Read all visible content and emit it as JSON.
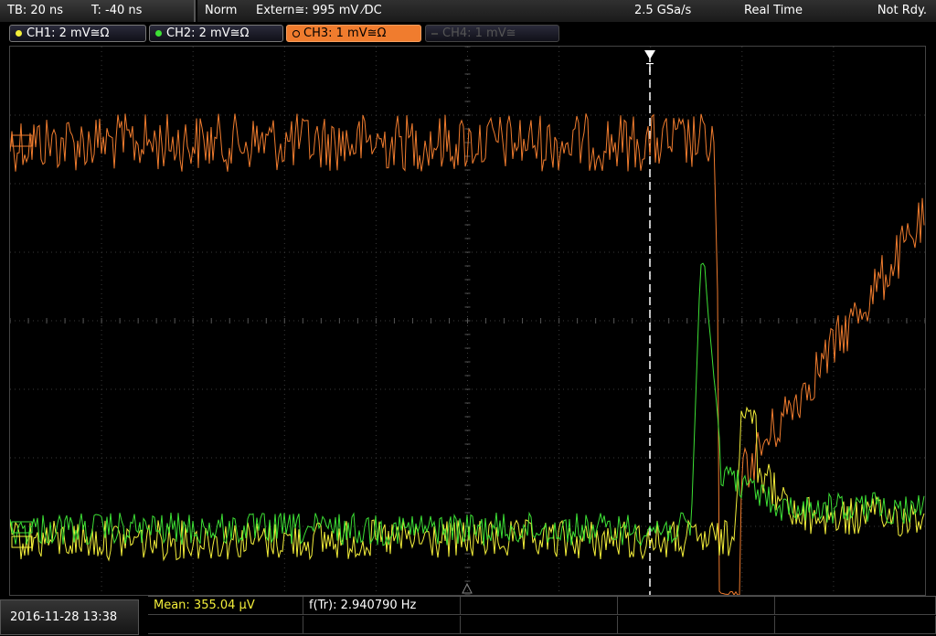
{
  "header": {
    "timebase": "TB: 20 ns",
    "trigger_offset": "T: -40 ns",
    "acq_mode": "Norm",
    "trigger_source": "Extern≅: 995 mV ⁄DC",
    "sample_rate": "2.5 GSa/s",
    "rt_mode": "Real Time",
    "status": "Not Rdy."
  },
  "channels": [
    {
      "label": "CH1: 2 mV≅Ω",
      "color": "#f4ef3a",
      "state": "on"
    },
    {
      "label": "CH2: 2 mV≅Ω",
      "color": "#3de035",
      "state": "on"
    },
    {
      "label": "CH3: 1 mV≅Ω",
      "color": "#f07c2e",
      "state": "active"
    },
    {
      "label": "CH4: 1 mV≅",
      "color": "#555555",
      "state": "off"
    }
  ],
  "trigger_marker": "T",
  "footer": {
    "datetime": "2016-11-28 13:38",
    "mean_label": "Mean: 355.04 µV",
    "freq_label": "f(Tr): 2.940790 Hz"
  },
  "colors": {
    "ch1": "#f4ef3a",
    "ch2": "#3de035",
    "ch3": "#f07c2e",
    "grid": "#3a3a3a"
  }
}
